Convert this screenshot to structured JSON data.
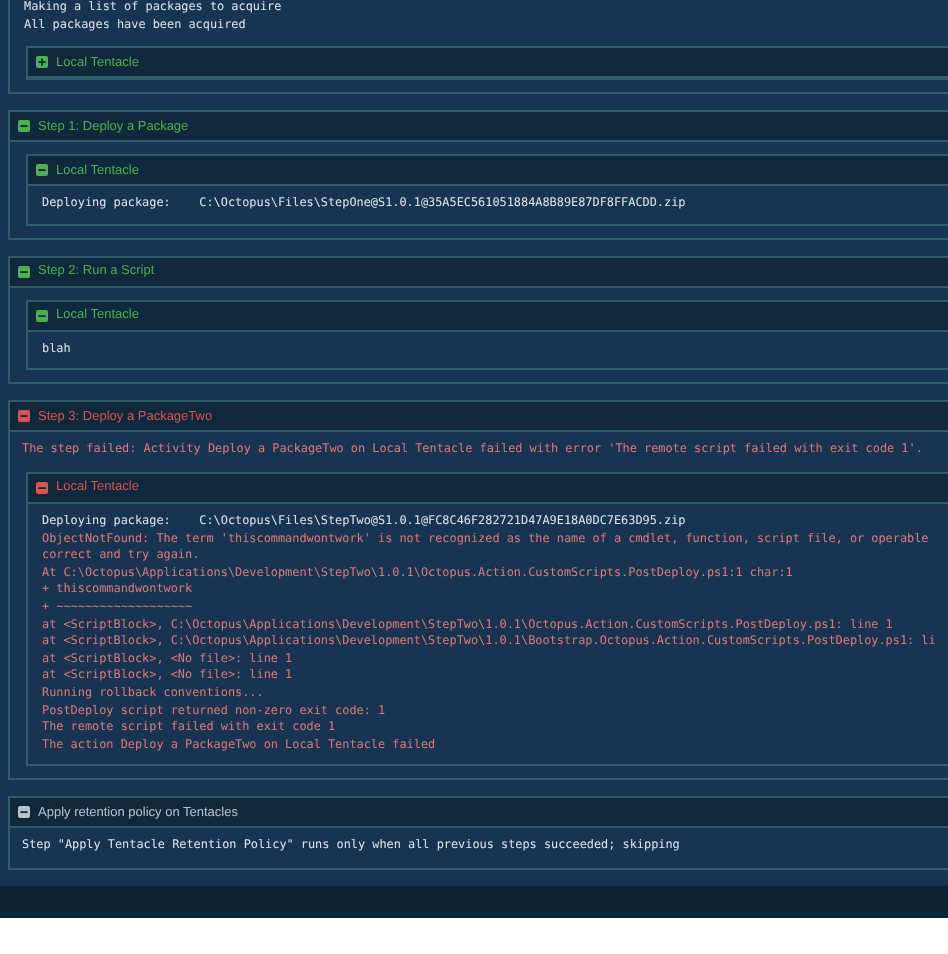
{
  "preamble": {
    "lines": [
      {
        "text": "Making a list of packages to acquire",
        "kind": "info"
      },
      {
        "text": "All packages have been acquired",
        "kind": "info"
      }
    ],
    "targets": [
      {
        "title": "Local Tentacle",
        "kind": "success",
        "expanded": false
      }
    ]
  },
  "steps": [
    {
      "title": "Step 1: Deploy a Package",
      "kind": "success",
      "expanded": true,
      "targets": [
        {
          "title": "Local Tentacle",
          "kind": "success",
          "expanded": true,
          "lines": [
            {
              "text": "Deploying package:    C:\\Octopus\\Files\\StepOne@S1.0.1@35A5EC561051884A8B89E87DF8FFACDD.zip",
              "kind": "info"
            }
          ]
        }
      ]
    },
    {
      "title": "Step 2: Run a Script",
      "kind": "success",
      "expanded": true,
      "targets": [
        {
          "title": "Local Tentacle",
          "kind": "success",
          "expanded": true,
          "lines": [
            {
              "text": "blah",
              "kind": "info"
            }
          ]
        }
      ]
    },
    {
      "title": "Step 3: Deploy a PackageTwo",
      "kind": "failed",
      "expanded": true,
      "lines": [
        {
          "text": "The step failed: Activity Deploy a PackageTwo on Local Tentacle failed with error 'The remote script failed with exit code 1'.",
          "kind": "error"
        }
      ],
      "targets": [
        {
          "title": "Local Tentacle",
          "kind": "failed",
          "expanded": true,
          "lines": [
            {
              "text": "Deploying package:    C:\\Octopus\\Files\\StepTwo@S1.0.1@FC8C46F282721D47A9E18A0DC7E63D95.zip",
              "kind": "info"
            },
            {
              "text": "ObjectNotFound: The term 'thiscommandwontwork' is not recognized as the name of a cmdlet, function, script file, or operable",
              "kind": "error"
            },
            {
              "text": "correct and try again.",
              "kind": "error"
            },
            {
              "text": "At C:\\Octopus\\Applications\\Development\\StepTwo\\1.0.1\\Octopus.Action.CustomScripts.PostDeploy.ps1:1 char:1",
              "kind": "error"
            },
            {
              "text": "+ thiscommandwontwork",
              "kind": "error"
            },
            {
              "text": "+ ~~~~~~~~~~~~~~~~~~~",
              "kind": "error"
            },
            {
              "text": "at <ScriptBlock>, C:\\Octopus\\Applications\\Development\\StepTwo\\1.0.1\\Octopus.Action.CustomScripts.PostDeploy.ps1: line 1",
              "kind": "error"
            },
            {
              "text": "at <ScriptBlock>, C:\\Octopus\\Applications\\Development\\StepTwo\\1.0.1\\Bootstrap.Octopus.Action.CustomScripts.PostDeploy.ps1: li",
              "kind": "error"
            },
            {
              "text": "at <ScriptBlock>, <No file>: line 1",
              "kind": "error"
            },
            {
              "text": "at <ScriptBlock>, <No file>: line 1",
              "kind": "error"
            },
            {
              "text": "Running rollback conventions...",
              "kind": "error"
            },
            {
              "text": "PostDeploy script returned non-zero exit code: 1",
              "kind": "error"
            },
            {
              "text": "The remote script failed with exit code 1",
              "kind": "error"
            },
            {
              "text": "The action Deploy a PackageTwo on Local Tentacle failed",
              "kind": "error"
            }
          ]
        }
      ]
    },
    {
      "title": "Apply retention policy on Tentacles",
      "kind": "skipped",
      "expanded": true,
      "lines": [
        {
          "text": "Step \"Apply Tentacle Retention Policy\" runs only when all previous steps succeeded; skipping",
          "kind": "info"
        }
      ]
    }
  ]
}
